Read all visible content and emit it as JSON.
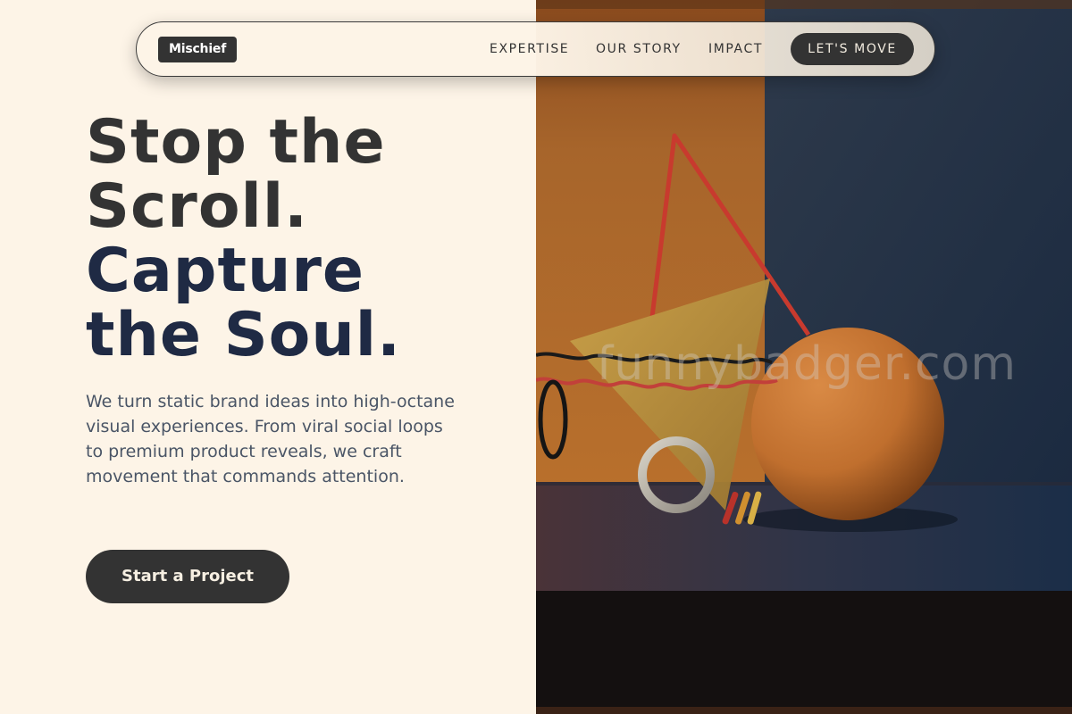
{
  "nav": {
    "logo": "Mischief",
    "links": [
      "EXPERTISE",
      "OUR STORY",
      "IMPACT"
    ],
    "cta": "LET'S MOVE"
  },
  "hero": {
    "headline_line1": "Stop the",
    "headline_line2": "Scroll.",
    "headline_line3": "Capture",
    "headline_line4": "the Soul.",
    "subtext": "We turn static brand ideas into high-octane visual experiences. From viral social loops to premium product reveals, we craft movement that commands attention.",
    "cta": "Start a Project"
  },
  "image": {
    "watermark": "funnybadger.com",
    "description_icon": "abstract-3d-shapes-render"
  },
  "colors": {
    "background": "#fdf4e7",
    "dark": "#333333",
    "navy": "#1f2a44",
    "body_text": "#4a5566"
  }
}
